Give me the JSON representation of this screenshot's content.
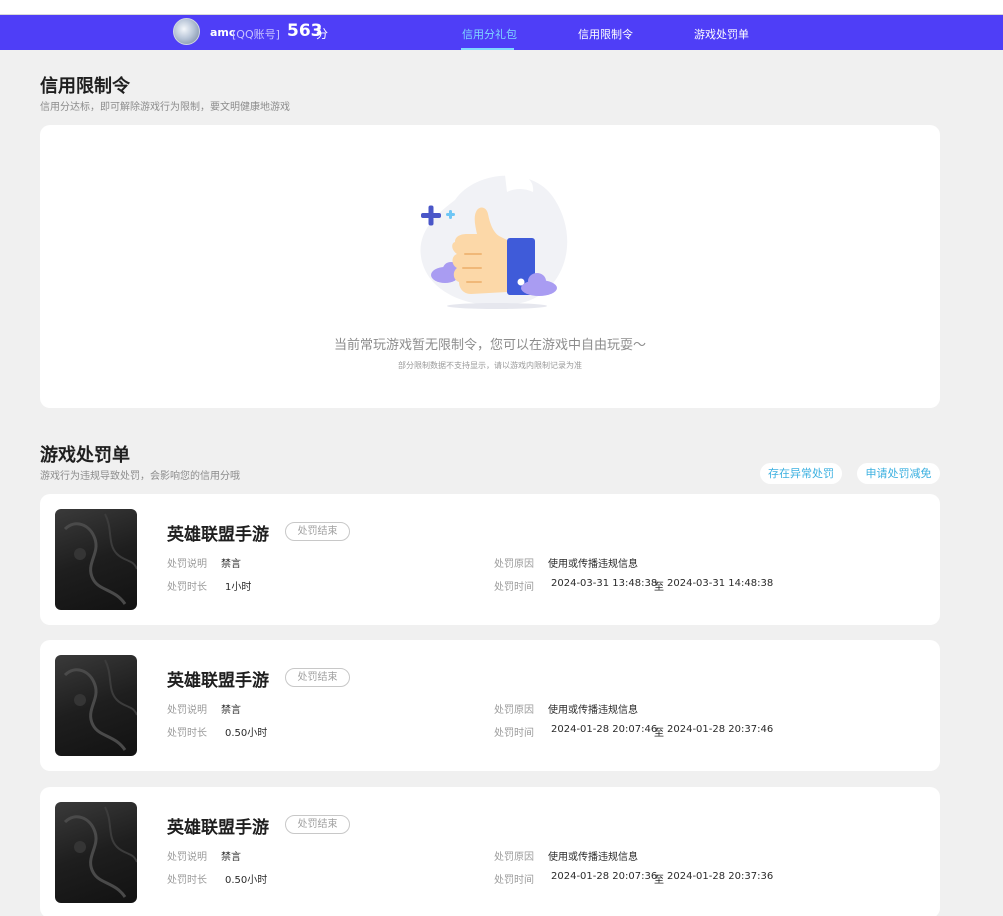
{
  "header": {
    "username": "amc",
    "account_type": "[QQ账号]",
    "score": "563",
    "score_unit": "分",
    "tabs": [
      {
        "label": "信用分礼包",
        "active": true
      },
      {
        "label": "信用限制令",
        "active": false
      },
      {
        "label": "游戏处罚单",
        "active": false
      }
    ]
  },
  "restriction": {
    "title": "信用限制令",
    "subtitle": "信用分达标，即可解除游戏行为限制，要文明健康地游戏",
    "empty_text": "当前常玩游戏暂无限制令，您可以在游戏中自由玩耍～",
    "empty_note": "部分限制数据不支持显示，请以游戏内限制记录为准"
  },
  "punishment": {
    "title": "游戏处罚单",
    "subtitle": "游戏行为违规导致处罚，会影响您的信用分哦",
    "abnormal_button": "存在异常处罚",
    "appeal_button": "申请处罚减免",
    "labels": {
      "desc": "处罚说明",
      "duration": "处罚时长",
      "reason": "处罚原因",
      "time": "处罚时间",
      "to": "至"
    },
    "items": [
      {
        "game": "英雄联盟手游",
        "status": "处罚结束",
        "desc": "禁言",
        "duration": "1小时",
        "reason": "使用或传播违规信息",
        "start": "2024-03-31 13:48:38",
        "end": "2024-03-31 14:48:38"
      },
      {
        "game": "英雄联盟手游",
        "status": "处罚结束",
        "desc": "禁言",
        "duration": "0.50小时",
        "reason": "使用或传播违规信息",
        "start": "2024-01-28 20:07:46",
        "end": "2024-01-28 20:37:46"
      },
      {
        "game": "英雄联盟手游",
        "status": "处罚结束",
        "desc": "禁言",
        "duration": "0.50小时",
        "reason": "使用或传播违规信息",
        "start": "2024-01-28 20:07:36",
        "end": "2024-01-28 20:37:36"
      }
    ]
  },
  "colors": {
    "brand": "#4f3ef7",
    "active_tab": "#7fd8ff",
    "link": "#3bb0e0"
  }
}
